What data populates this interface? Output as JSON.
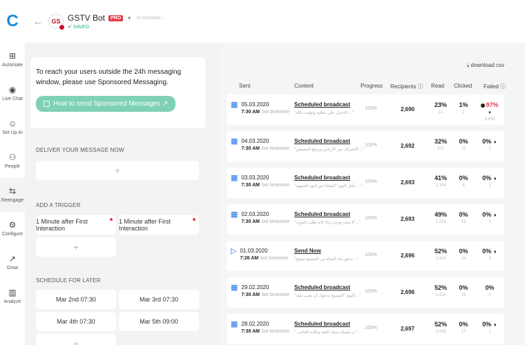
{
  "header": {
    "brand": "C",
    "back_icon": "←",
    "avatar_text": "GS",
    "bot_name": "GSTV Bot",
    "badge": "PRO",
    "link": "m.me/onlin...",
    "saved": "✔ SAVED"
  },
  "nav": {
    "items": [
      {
        "label": "Automate",
        "icon": "⊞"
      },
      {
        "label": "Live Chat",
        "icon": "◉"
      },
      {
        "label": "Set Up AI",
        "icon": "☺"
      },
      {
        "label": "People",
        "icon": "⚇"
      },
      {
        "label": "Reengage",
        "icon": "⇆"
      },
      {
        "label": "Configure",
        "icon": "⚙"
      },
      {
        "label": "Grow",
        "icon": "↗"
      },
      {
        "label": "Analyze",
        "icon": "▥"
      }
    ]
  },
  "sponsored": {
    "text": "To reach your users outside the 24h messaging window, please use Sponsored Messaging.",
    "button": "How to send Sponsored Messages ↗"
  },
  "sections": {
    "deliver": "DELIVER YOUR MESSAGE NOW",
    "trigger": "ADD A TRIGGER",
    "schedule": "SCHEDULE FOR LATER",
    "plus": "+"
  },
  "triggers": [
    "1 Minute after First Interaction",
    "1 Minute after First Interaction"
  ],
  "schedules": [
    "Mar 2nd 07:30",
    "Mar 3rd 07:30",
    "Mar 4th 07:30",
    "Mar 5th 09:00"
  ],
  "table": {
    "download": "⤓ download csv",
    "headers": {
      "sent": "Sent",
      "content": "Content",
      "progress": "Progress",
      "recipients": "Recipients ⓘ",
      "read": "Read",
      "clicked": "Clicked",
      "failed": "Failed ⓘ"
    },
    "rows": [
      {
        "date": "05.03.2020",
        "time": "7:30 AM",
        "tz": "bot timezone",
        "title": "Scheduled broadcast",
        "sub": "\"الاختبار على عطية وتوقيت الله ...\"",
        "progress": "100%",
        "recipients": "2,690",
        "read": "23%",
        "read_n": "13",
        "clicked": "1%",
        "clicked_n": "1",
        "failed": "97%",
        "failed_n": "2,635"
      },
      {
        "date": "04.03.2020",
        "time": "7:30 AM",
        "tz": "bot timezone",
        "title": "Scheduled broadcast",
        "sub": "\"الاعتراف من الأرباس ويرفع المشفين ...\"",
        "progress": "100%",
        "recipients": "2,692",
        "read": "32%",
        "read_n": "872",
        "clicked": "0%",
        "clicked_n": "12",
        "failed": "0%",
        "failed_n": "2"
      },
      {
        "date": "03.03.2020",
        "time": "7:30 AM",
        "tz": "bot timezone",
        "title": "Scheduled broadcast",
        "sub": "\"تأمل اليوم \"الشفاء من قيود الشهوة ...\"",
        "progress": "100%",
        "recipients": "2,693",
        "read": "41%",
        "read_n": "1,104",
        "clicked": "0%",
        "clicked_n": "8",
        "failed": "0%",
        "failed_n": "1"
      },
      {
        "date": "02.03.2020",
        "time": "7:30 AM",
        "tz": "bot timezone",
        "title": "Scheduled broadcast",
        "sub": "\"لا تخف يوجد رجاء لأنه طلب الموت ...\"",
        "progress": "100%",
        "recipients": "2,693",
        "read": "49%",
        "read_n": "1,324",
        "clicked": "0%",
        "clicked_n": "19",
        "failed": "0%",
        "failed_n": "3"
      },
      {
        "date": "01.03.2020",
        "time": "7:26 AM",
        "tz": "bot timezone",
        "title": "Send Now",
        "sub": "\"تدفق ماء الحياة من المسيح يسوع ...\"",
        "progress": "100%",
        "recipients": "2,696",
        "read": "52%",
        "read_n": "1,416",
        "clicked": "0%",
        "clicked_n": "14",
        "failed": "0%",
        "failed_n": "3"
      },
      {
        "date": "29.02.2020",
        "time": "7:30 AM",
        "tz": "bot timezone",
        "title": "Scheduled broadcast",
        "sub": "\"اليوم \"المسيح يدعوك أن تصير مثله ...\"",
        "progress": "100%",
        "recipients": "2,696",
        "read": "52%",
        "read_n": "1,428",
        "clicked": "0%",
        "clicked_n": "19",
        "failed": "0%",
        "failed_n": "0"
      },
      {
        "date": "28.02.2020",
        "time": "7:30 AM",
        "tz": "bot timezone",
        "title": "Scheduled broadcast",
        "sub": "\"...ب نفسك سبك الثقة وعلاية العالم\"",
        "progress": "100%",
        "recipients": "2,697",
        "read": "52%",
        "read_n": "1,409",
        "clicked": "0%",
        "clicked_n": "17",
        "failed": "0%",
        "failed_n": "1"
      }
    ]
  },
  "colors": {
    "brand": "#1a8cd8",
    "accent": "#7fd1b3",
    "danger": "#e63946",
    "calendar": "#1a73e8"
  }
}
